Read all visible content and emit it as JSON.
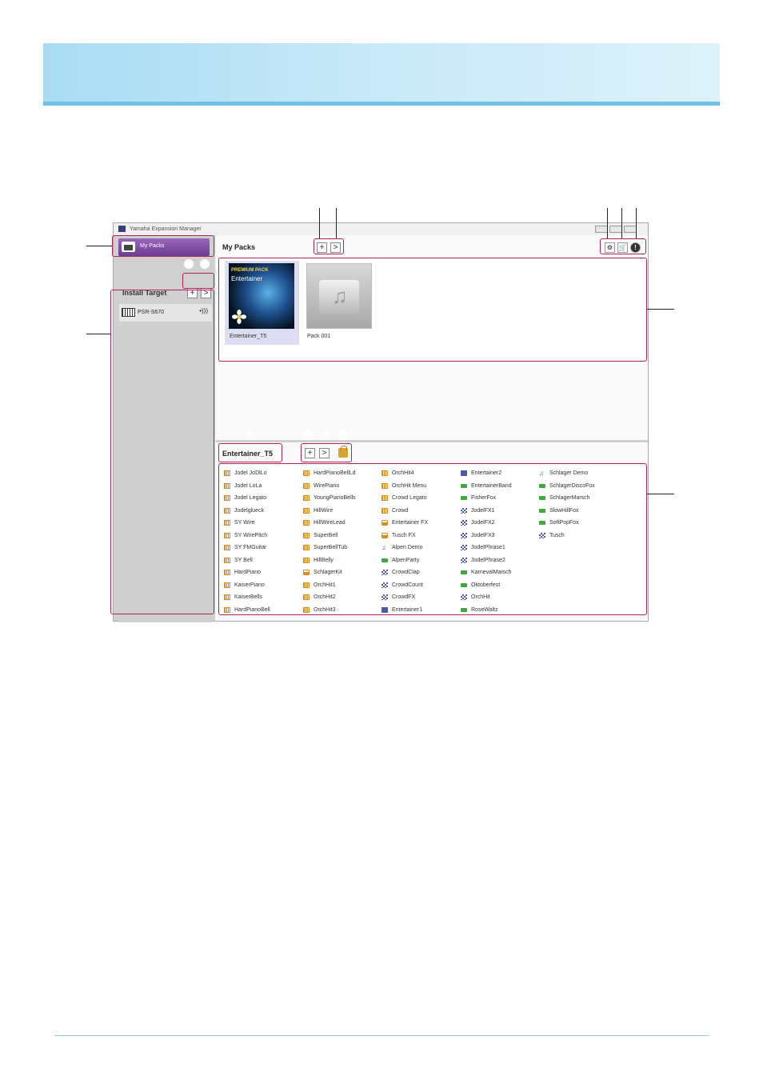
{
  "window": {
    "title": "Yamaha Expansion Manager"
  },
  "sidebar": {
    "my_packs_label": "My Packs",
    "install_target_title": "Install Target",
    "add_label": "+",
    "next_label": ">",
    "targets": [
      "PSR-S670"
    ]
  },
  "packs": {
    "title": "My Packs",
    "add_label": "+",
    "next_label": ">",
    "items": [
      {
        "name": "Entertainer_T5",
        "thumb_badge": "PREMIUM PACK",
        "thumb_title": "Entertainer"
      },
      {
        "name": "Pack 001"
      }
    ]
  },
  "tools": {
    "settings_icon": "gear-icon",
    "shop_icon": "cart-icon",
    "info_icon": "info-icon"
  },
  "content": {
    "title": "Entertainer_T5",
    "add_label": "+",
    "next_label": ">",
    "lock_icon": "lock-icon",
    "columns": [
      [
        {
          "label": "Jodel JoDlLo",
          "icon": "piano"
        },
        {
          "label": "Jodel LoLa",
          "icon": "piano"
        },
        {
          "label": "Jodel Legato",
          "icon": "piano"
        },
        {
          "label": "Jodelglueck",
          "icon": "piano"
        },
        {
          "label": "SY Wire",
          "icon": "piano"
        },
        {
          "label": "SY WirePitch",
          "icon": "piano"
        },
        {
          "label": "SY FMGuitar",
          "icon": "piano"
        },
        {
          "label": "SY Bell",
          "icon": "piano"
        },
        {
          "label": "HardPiano",
          "icon": "piano"
        },
        {
          "label": "KaiserPiano",
          "icon": "piano"
        },
        {
          "label": "KaiserBells",
          "icon": "piano"
        },
        {
          "label": "HardPianoBell",
          "icon": "piano"
        }
      ],
      [
        {
          "label": "HardPianoBellLd",
          "icon": "piano"
        },
        {
          "label": "WirePiano",
          "icon": "piano"
        },
        {
          "label": "YoungPianoBells",
          "icon": "piano"
        },
        {
          "label": "HillWire",
          "icon": "piano"
        },
        {
          "label": "HillWireLead",
          "icon": "piano"
        },
        {
          "label": "SuperBell",
          "icon": "piano"
        },
        {
          "label": "SuperBellTub",
          "icon": "piano"
        },
        {
          "label": "HillBelly",
          "icon": "piano"
        },
        {
          "label": "SchlagerKit",
          "icon": "drum"
        },
        {
          "label": "OrchHit1",
          "icon": "piano"
        },
        {
          "label": "OrchHit2",
          "icon": "piano"
        },
        {
          "label": "OrchHit3",
          "icon": "piano"
        }
      ],
      [
        {
          "label": "OrchHit4",
          "icon": "piano"
        },
        {
          "label": "OrchHit Menu",
          "icon": "piano"
        },
        {
          "label": "Crowd Legato",
          "icon": "piano"
        },
        {
          "label": "Crowd",
          "icon": "piano"
        },
        {
          "label": "Entertainer FX",
          "icon": "drum"
        },
        {
          "label": "Tusch FX",
          "icon": "drum"
        },
        {
          "label": "Alpen Demo",
          "icon": "music"
        },
        {
          "label": "AlpenParty",
          "icon": "style"
        },
        {
          "label": "CrowdClap",
          "icon": "grid"
        },
        {
          "label": "CrowdCount",
          "icon": "grid"
        },
        {
          "label": "CrowdFX",
          "icon": "grid"
        },
        {
          "label": "Entertainer1",
          "icon": "doc"
        }
      ],
      [
        {
          "label": "Entertainer2",
          "icon": "doc"
        },
        {
          "label": "EntertainerBand",
          "icon": "style"
        },
        {
          "label": "FisherFox",
          "icon": "style"
        },
        {
          "label": "JodelFX1",
          "icon": "grid"
        },
        {
          "label": "JodelFX2",
          "icon": "grid"
        },
        {
          "label": "JodelFX3",
          "icon": "grid"
        },
        {
          "label": "JodelPhrase1",
          "icon": "grid"
        },
        {
          "label": "JodelPhrase2",
          "icon": "grid"
        },
        {
          "label": "KarnevalMarsch",
          "icon": "style"
        },
        {
          "label": "Oktoberfest",
          "icon": "style"
        },
        {
          "label": "OrchHit",
          "icon": "grid"
        },
        {
          "label": "RoseWaltz",
          "icon": "style"
        }
      ],
      [
        {
          "label": "Schlager Demo",
          "icon": "music"
        },
        {
          "label": "SchlagerDiscoFox",
          "icon": "style"
        },
        {
          "label": "SchlagerMarsch",
          "icon": "style"
        },
        {
          "label": "SlowHillFox",
          "icon": "style"
        },
        {
          "label": "SoftPopFox",
          "icon": "style"
        },
        {
          "label": "Tusch",
          "icon": "grid"
        }
      ]
    ]
  },
  "accent_colors": {
    "highlight": "#b0245e",
    "banner": "#a9dcf4",
    "my_packs_button": "#7a4a9e"
  }
}
